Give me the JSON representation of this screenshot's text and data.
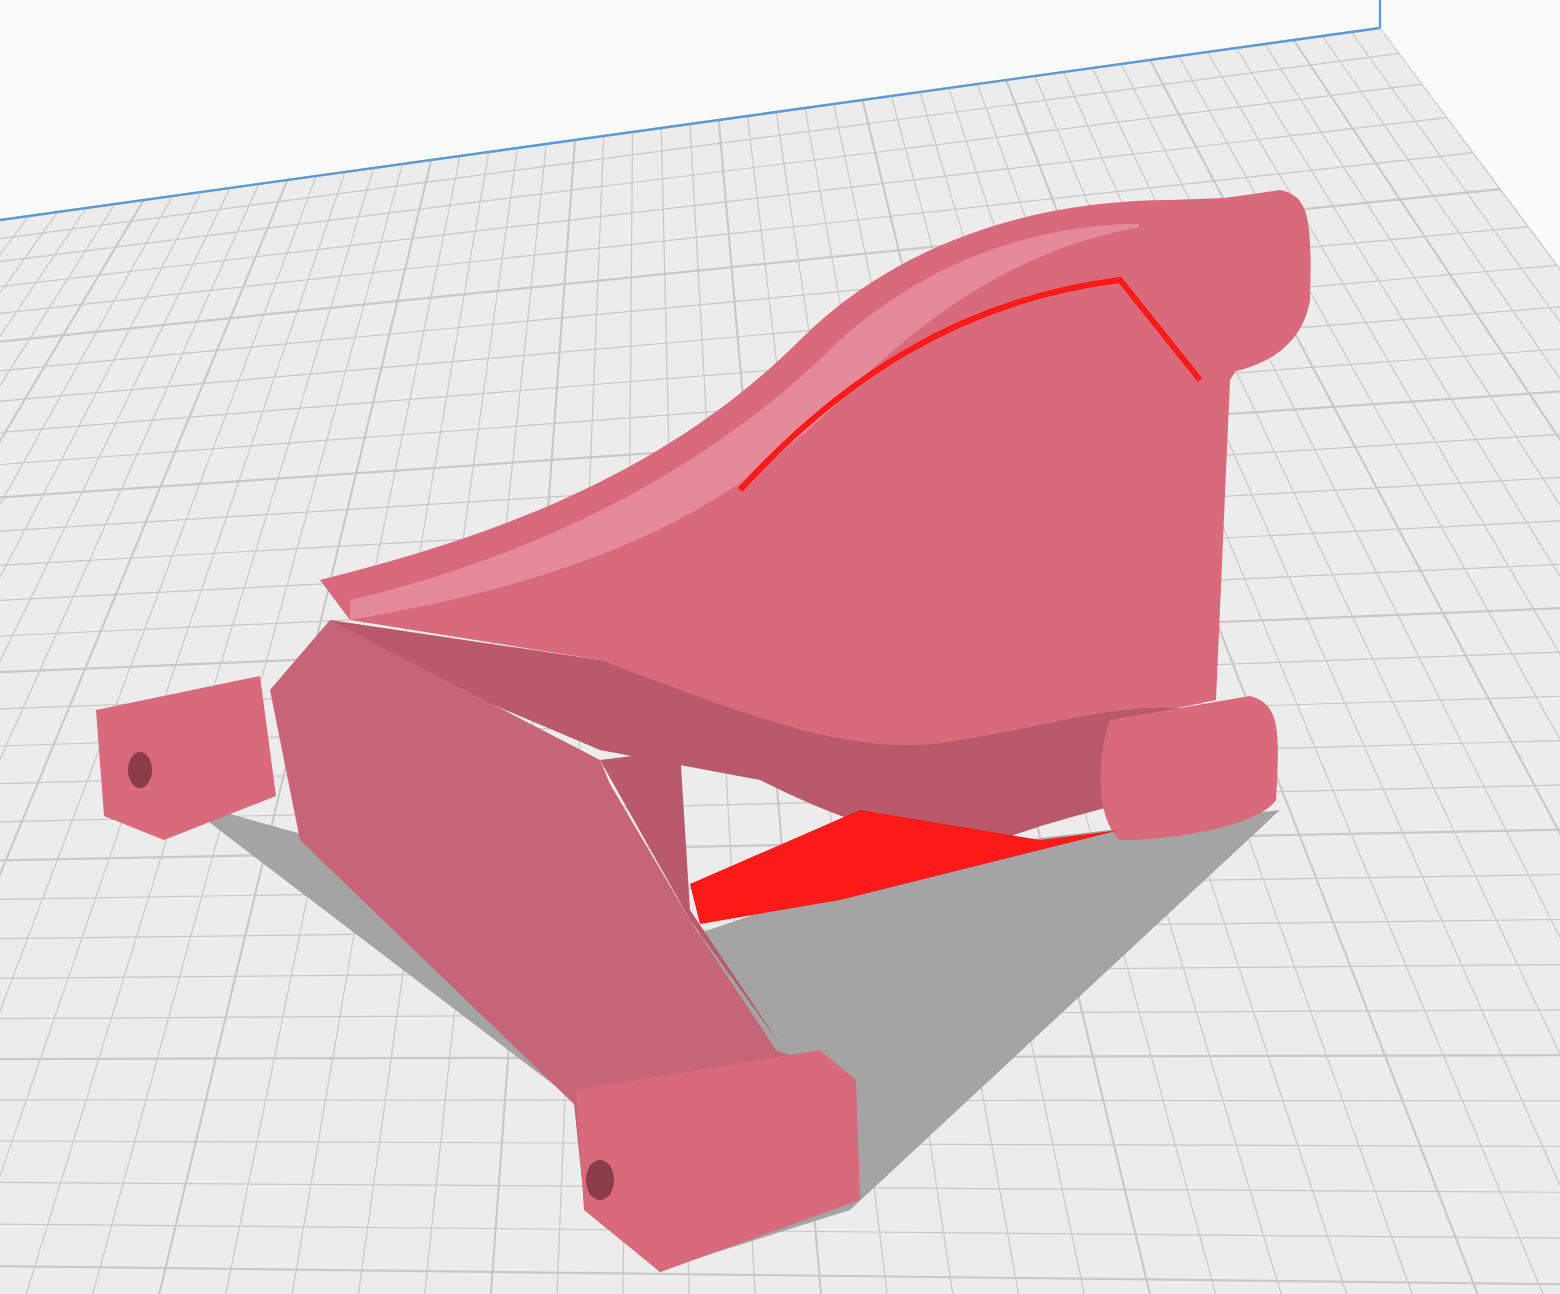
{
  "viewport": {
    "model": {
      "overhang_highlighted": true
    }
  }
}
